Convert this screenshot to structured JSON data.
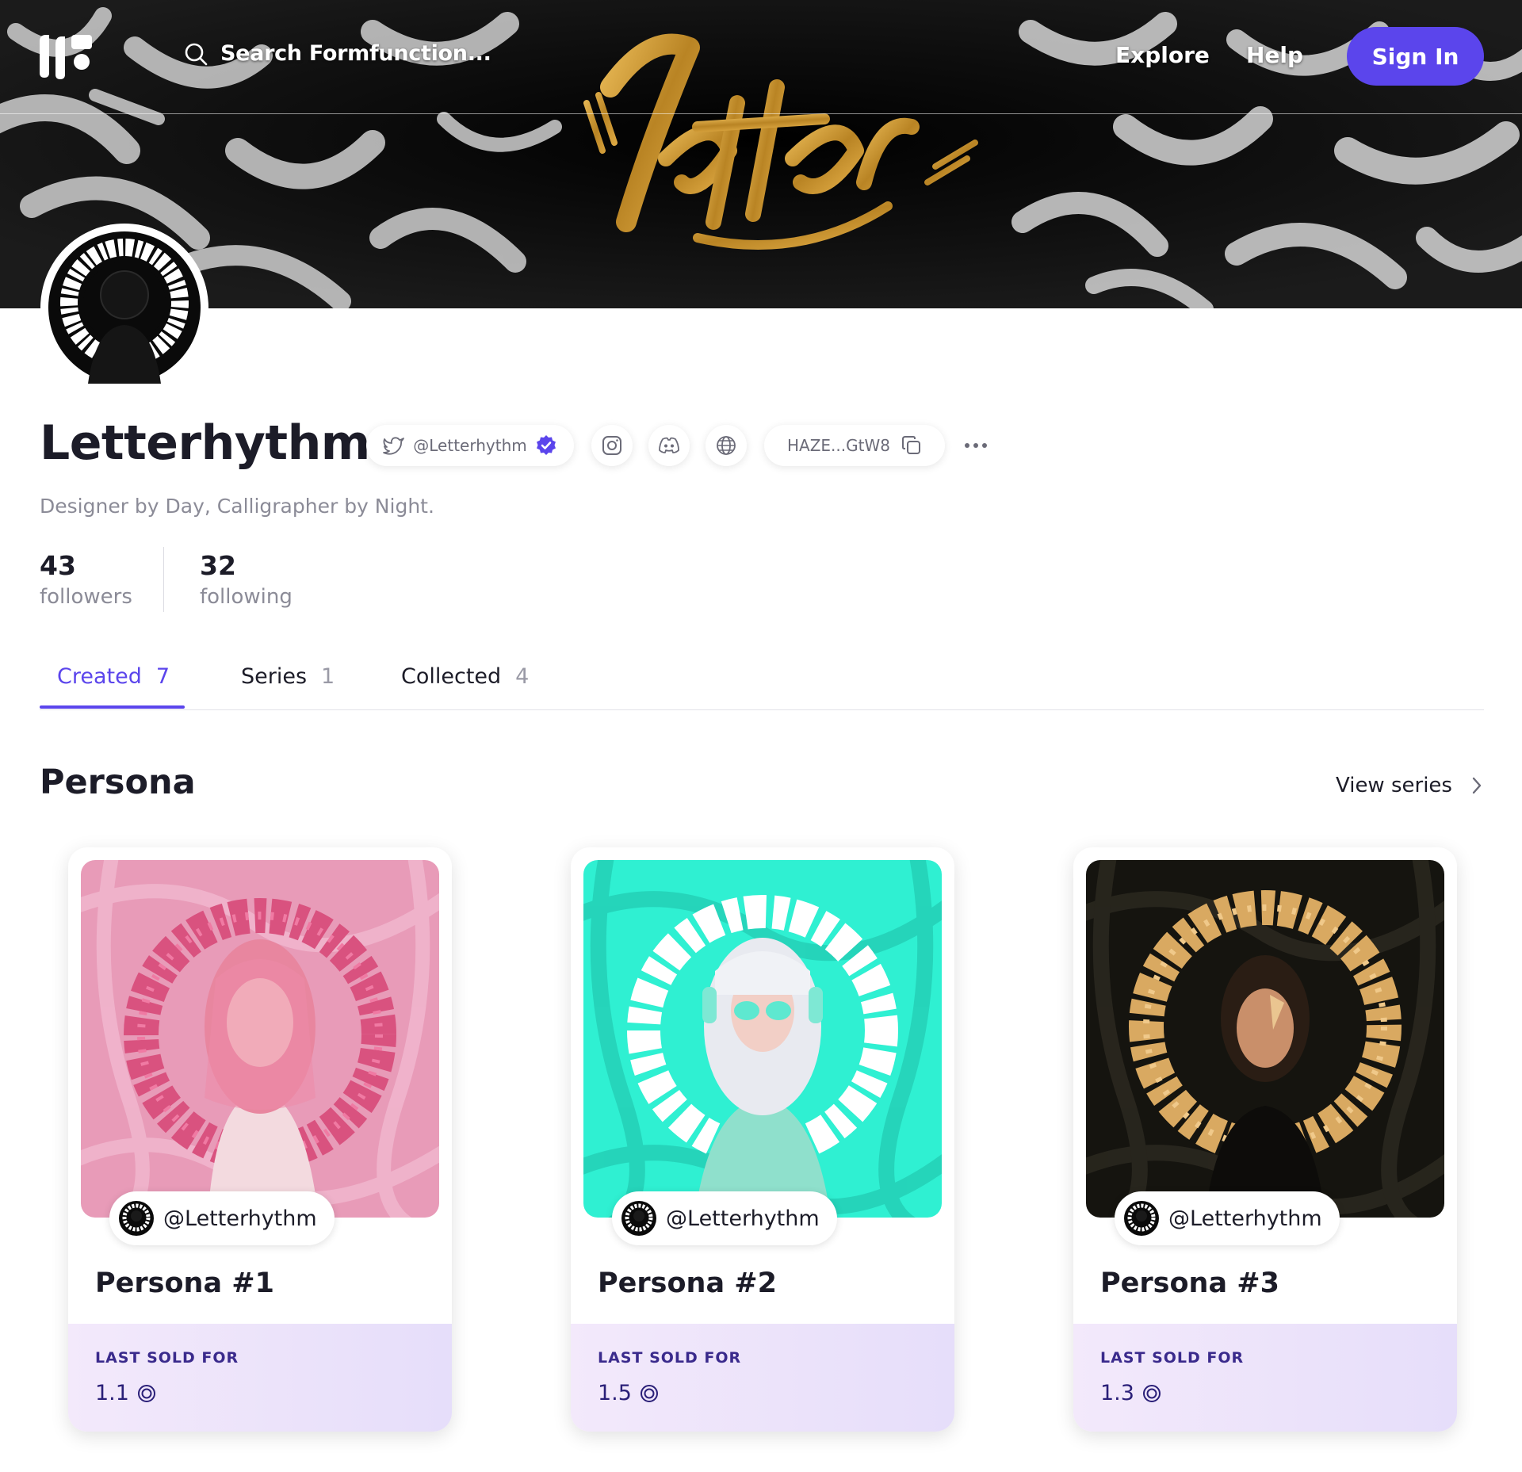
{
  "header": {
    "search_placeholder": "Search Formfunction...",
    "nav": {
      "explore": "Explore",
      "help": "Help"
    },
    "sign_in": "Sign In",
    "banner_text": "letter"
  },
  "profile": {
    "name": "Letterhythm",
    "twitter_handle": "@Letterhythm",
    "wallet": "HAZE...GtW8",
    "bio": "Designer by Day, Calligrapher by Night.",
    "stats": {
      "followers_count": "43",
      "followers_label": "followers",
      "following_count": "32",
      "following_label": "following"
    }
  },
  "tabs": [
    {
      "label": "Created",
      "count": "7"
    },
    {
      "label": "Series",
      "count": "1"
    },
    {
      "label": "Collected",
      "count": "4"
    }
  ],
  "series": {
    "title": "Persona",
    "view_link": "View series",
    "cards": [
      {
        "creator": "@Letterhythm",
        "title": "Persona #1",
        "sold_label": "LAST SOLD FOR",
        "price": "1.1"
      },
      {
        "creator": "@Letterhythm",
        "title": "Persona #2",
        "sold_label": "LAST SOLD FOR",
        "price": "1.5"
      },
      {
        "creator": "@Letterhythm",
        "title": "Persona #3",
        "sold_label": "LAST SOLD FOR",
        "price": "1.3"
      }
    ]
  },
  "colors": {
    "accent": "#5b45ec",
    "text_primary": "#1c1c28",
    "text_muted": "#8b8b97",
    "card1_bg": "#e89bb8",
    "card2_bg": "#2ff0d2",
    "card3_bg": "#15140f",
    "banner_gold": "#c9952e"
  },
  "icons": {
    "search": "search-icon",
    "twitter": "twitter-icon",
    "verified": "verified-badge-icon",
    "instagram": "instagram-icon",
    "discord": "discord-icon",
    "website": "globe-icon",
    "copy": "copy-icon",
    "more": "more-dots-icon",
    "chevron": "chevron-right-icon",
    "sol": "sol-currency-icon"
  }
}
